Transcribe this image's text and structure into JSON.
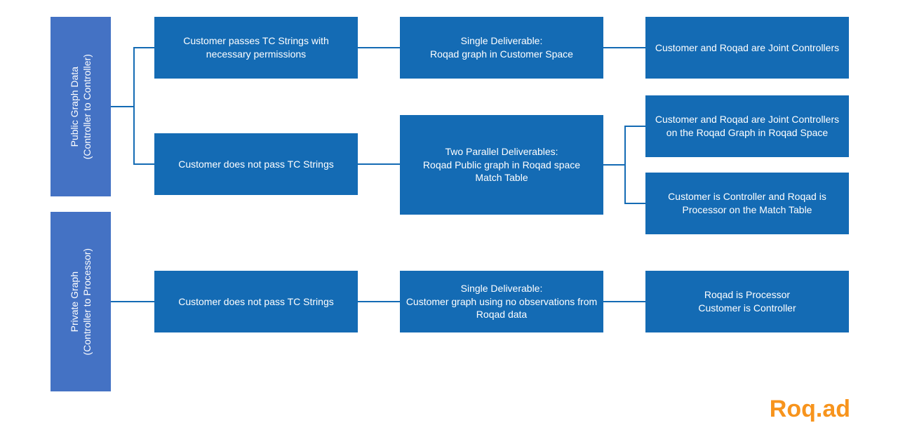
{
  "labels": {
    "public": {
      "line1": "Public Graph Data",
      "line2": "(Controller to Controller)"
    },
    "private": {
      "line1": "Private Graph",
      "line2": "(Controller to Processor)"
    }
  },
  "row1": {
    "a": "Customer passes TC Strings with necessary permissions",
    "b_line1": "Single Deliverable:",
    "b_line2": "Roqad graph in Customer Space",
    "c": "Customer and Roqad are Joint Controllers"
  },
  "row2": {
    "a": "Customer does not pass TC Strings",
    "b_line1": "Two Parallel Deliverables:",
    "b_line2": "Roqad Public graph in Roqad space",
    "b_line3": "Match Table",
    "c1": "Customer and Roqad are Joint Controllers on the Roqad Graph in Roqad Space",
    "c2": "Customer is Controller and Roqad is Processor on the Match Table"
  },
  "row3": {
    "a": "Customer does not pass TC Strings",
    "b_line1": "Single Deliverable:",
    "b_line2": "Customer graph using no observations from Roqad data",
    "c_line1": "Roqad is Processor",
    "c_line2": "Customer is Controller"
  },
  "brand": "Roq.ad",
  "colors": {
    "box": "#146bb4",
    "label": "#4472c4",
    "brand": "#f7941d"
  }
}
